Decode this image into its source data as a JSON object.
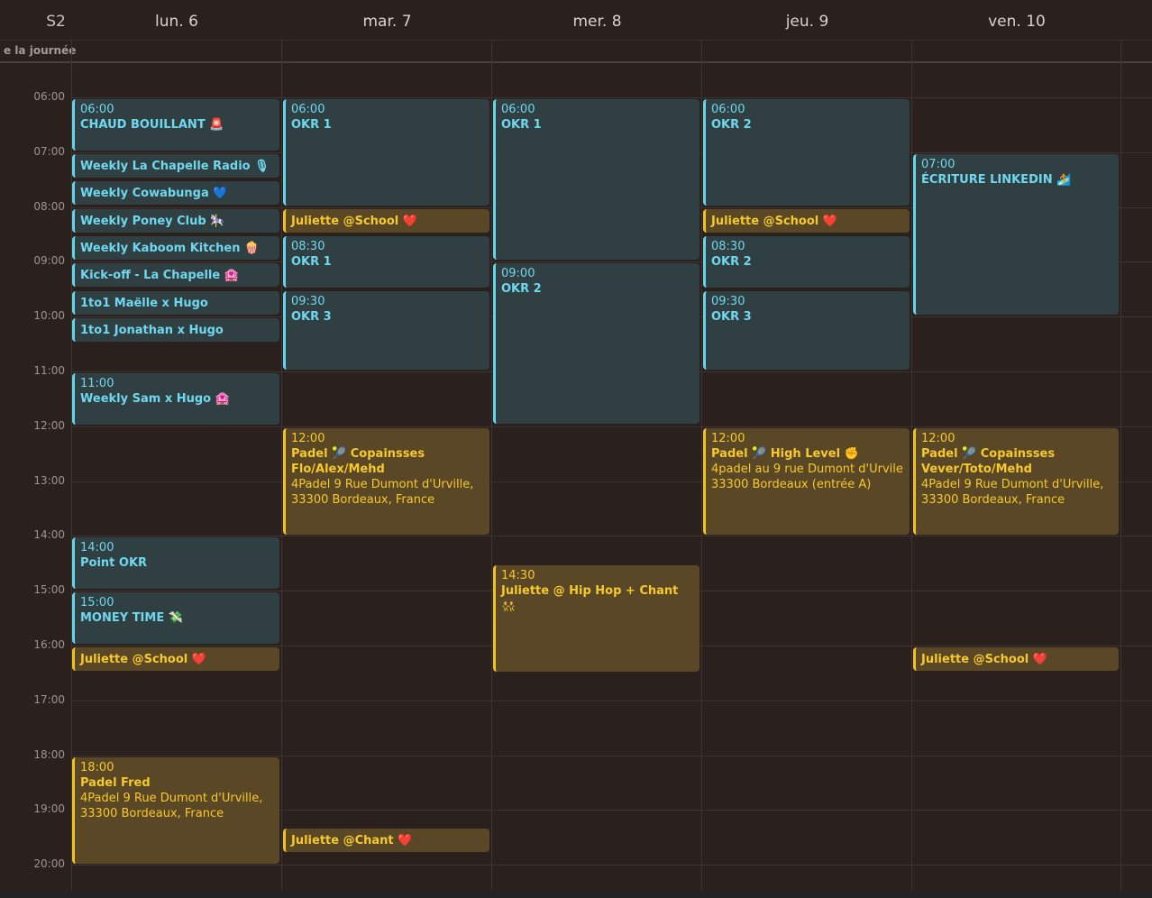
{
  "header": {
    "week_label": "S2",
    "days": [
      "lun. 6",
      "mar. 7",
      "mer. 8",
      "jeu. 9",
      "ven. 10"
    ],
    "all_day_label": "e la journée"
  },
  "hours": [
    "06:00",
    "07:00",
    "08:00",
    "09:00",
    "10:00",
    "11:00",
    "12:00",
    "13:00",
    "14:00",
    "15:00",
    "16:00",
    "17:00",
    "18:00",
    "19:00",
    "20:00"
  ],
  "events": [
    {
      "day": 0,
      "start": 6.0,
      "end": 7.0,
      "color": "blue",
      "time": "06:00",
      "title": "CHAUD BOUILLANT 🚨"
    },
    {
      "day": 0,
      "start": 7.0,
      "end": 7.5,
      "color": "blue",
      "time": "",
      "title": "Weekly La Chapelle Radio 🎙"
    },
    {
      "day": 0,
      "start": 7.5,
      "end": 8.0,
      "color": "blue",
      "time": "",
      "title": "Weekly Cowabunga 💙"
    },
    {
      "day": 0,
      "start": 8.0,
      "end": 8.5,
      "color": "blue",
      "time": "",
      "title": "Weekly Poney Club 🎠"
    },
    {
      "day": 0,
      "start": 8.5,
      "end": 9.0,
      "color": "blue",
      "time": "",
      "title": "Weekly Kaboom Kitchen 🍿"
    },
    {
      "day": 0,
      "start": 9.0,
      "end": 9.5,
      "color": "blue",
      "time": "",
      "title": "Kick-off - La Chapelle 🏩"
    },
    {
      "day": 0,
      "start": 9.5,
      "end": 10.0,
      "color": "blue",
      "time": "",
      "title": "1to1 Maëlle x Hugo"
    },
    {
      "day": 0,
      "start": 10.0,
      "end": 10.5,
      "color": "blue",
      "time": "",
      "title": "1to1 Jonathan x Hugo"
    },
    {
      "day": 0,
      "start": 11.0,
      "end": 12.0,
      "color": "blue",
      "time": "11:00",
      "title": "Weekly Sam x Hugo 🏩"
    },
    {
      "day": 0,
      "start": 14.0,
      "end": 15.0,
      "color": "blue",
      "time": "14:00",
      "title": "Point OKR"
    },
    {
      "day": 0,
      "start": 15.0,
      "end": 16.0,
      "color": "blue",
      "time": "15:00",
      "title": "MONEY TIME 💸"
    },
    {
      "day": 0,
      "start": 16.0,
      "end": 16.5,
      "color": "yellow",
      "time": "",
      "title": "Juliette @School ❤️"
    },
    {
      "day": 0,
      "start": 18.0,
      "end": 20.0,
      "color": "yellow",
      "time": "18:00",
      "title": "Padel Fred",
      "location": "4Padel 9 Rue Dumont d'Urville, 33300 Bordeaux, France"
    },
    {
      "day": 1,
      "start": 6.0,
      "end": 8.0,
      "color": "blue",
      "time": "06:00",
      "title": "OKR 1"
    },
    {
      "day": 1,
      "start": 8.0,
      "end": 8.5,
      "color": "yellow",
      "time": "",
      "title": "Juliette @School ❤️"
    },
    {
      "day": 1,
      "start": 8.5,
      "end": 9.5,
      "color": "blue",
      "time": "08:30",
      "title": "OKR 1"
    },
    {
      "day": 1,
      "start": 9.5,
      "end": 11.0,
      "color": "blue",
      "time": "09:30",
      "title": "OKR 3"
    },
    {
      "day": 1,
      "start": 12.0,
      "end": 14.0,
      "color": "yellow",
      "time": "12:00",
      "title": "Padel 🎾 Copainsses Flo/Alex/Mehd",
      "location": "4Padel 9 Rue Dumont d'Urville, 33300 Bordeaux, France"
    },
    {
      "day": 1,
      "start": 19.3,
      "end": 19.8,
      "color": "yellow",
      "time": "",
      "title": "Juliette @Chant ❤️"
    },
    {
      "day": 2,
      "start": 6.0,
      "end": 9.0,
      "color": "blue",
      "time": "06:00",
      "title": "OKR 1"
    },
    {
      "day": 2,
      "start": 9.0,
      "end": 12.0,
      "color": "blue",
      "time": "09:00",
      "title": "OKR 2"
    },
    {
      "day": 2,
      "start": 14.5,
      "end": 16.5,
      "color": "yellow",
      "time": "14:30",
      "title": "Juliette @ Hip Hop + Chant 👯"
    },
    {
      "day": 3,
      "start": 6.0,
      "end": 8.0,
      "color": "blue",
      "time": "06:00",
      "title": "OKR 2"
    },
    {
      "day": 3,
      "start": 8.0,
      "end": 8.5,
      "color": "yellow",
      "time": "",
      "title": "Juliette @School ❤️"
    },
    {
      "day": 3,
      "start": 8.5,
      "end": 9.5,
      "color": "blue",
      "time": "08:30",
      "title": "OKR 2"
    },
    {
      "day": 3,
      "start": 9.5,
      "end": 11.0,
      "color": "blue",
      "time": "09:30",
      "title": "OKR 3"
    },
    {
      "day": 3,
      "start": 12.0,
      "end": 14.0,
      "color": "yellow",
      "time": "12:00",
      "title": "Padel 🎾 High Level ✊",
      "location": "4padel au 9 rue Dumont d'Urvile 33300 Bordeaux (entrée A)"
    },
    {
      "day": 4,
      "start": 7.0,
      "end": 10.0,
      "color": "blue",
      "time": "07:00",
      "title": "ÉCRITURE LINKEDIN 🏄"
    },
    {
      "day": 4,
      "start": 12.0,
      "end": 14.0,
      "color": "yellow",
      "time": "12:00",
      "title": "Padel 🎾 Copainsses Vever/Toto/Mehd",
      "location": "4Padel 9 Rue Dumont d'Urville, 33300 Bordeaux, France"
    },
    {
      "day": 4,
      "start": 16.0,
      "end": 16.5,
      "color": "yellow",
      "time": "",
      "title": "Juliette @School ❤️"
    }
  ]
}
